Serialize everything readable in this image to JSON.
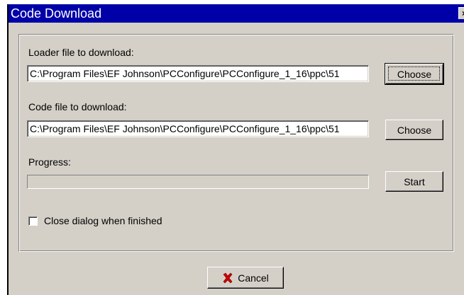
{
  "window": {
    "title": "Code Download",
    "close_glyph": "×"
  },
  "loader": {
    "label": "Loader file to download:",
    "path": "C:\\Program Files\\EF Johnson\\PCConfigure\\PCConfigure_1_16\\ppc\\51",
    "choose_label": "Choose"
  },
  "code": {
    "label": "Code file to download:",
    "path": "C:\\Program Files\\EF Johnson\\PCConfigure\\PCConfigure_1_16\\ppc\\51",
    "choose_label": "Choose"
  },
  "progress": {
    "label": "Progress:",
    "value_percent": 0,
    "start_label": "Start"
  },
  "options": {
    "close_when_finished_label": "Close dialog when finished",
    "close_when_finished_checked": false
  },
  "footer": {
    "cancel_label": "Cancel",
    "cancel_icon": "red-x-icon"
  },
  "colors": {
    "titlebar": "#0000a8",
    "face": "#d4d0c8",
    "cancel_icon": "#cc0000"
  }
}
